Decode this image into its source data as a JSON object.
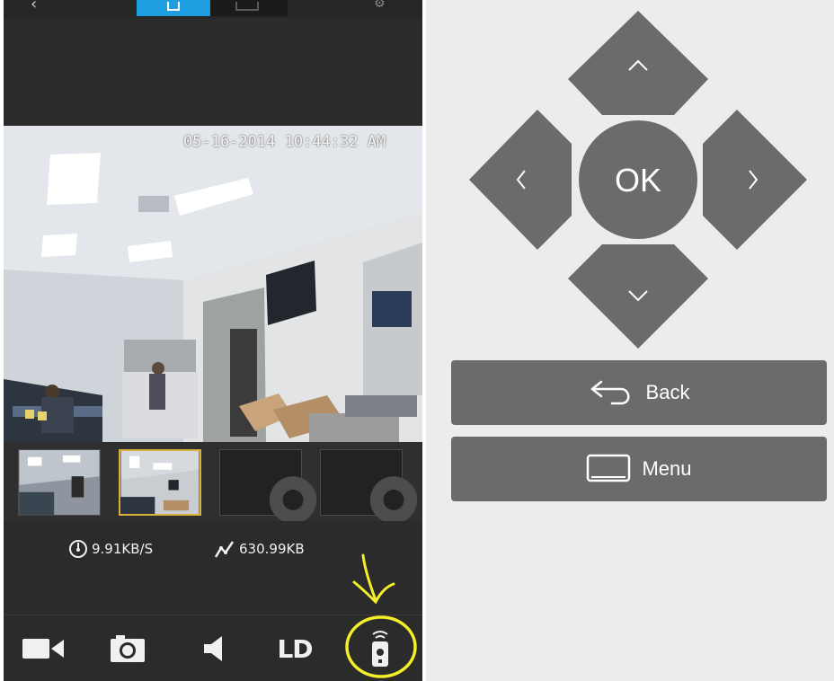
{
  "left_app": {
    "video": {
      "timestamp": "05-16-2014 10:44:32 AM"
    },
    "stats": {
      "speed": "9.91KB/S",
      "total": "630.99KB"
    },
    "toolbar": {
      "ld_label": "LD"
    },
    "thumbnails": [
      {
        "name": "camera-1",
        "selected": false,
        "has_preview": true
      },
      {
        "name": "camera-2",
        "selected": true,
        "has_preview": true
      },
      {
        "name": "camera-3",
        "selected": false,
        "has_preview": false
      },
      {
        "name": "camera-4",
        "selected": false,
        "has_preview": false
      }
    ],
    "icons": [
      "back-arrow-icon",
      "video-camera-icon",
      "snapshot-camera-icon",
      "speaker-icon",
      "remote-control-icon"
    ]
  },
  "remote": {
    "ok_label": "OK",
    "back_label": "Back",
    "menu_label": "Menu",
    "colors": {
      "button": "#6b6b6b",
      "background": "#ececec",
      "annotation": "#f2ee2a",
      "selected_thumb": "#d8b13a"
    }
  }
}
